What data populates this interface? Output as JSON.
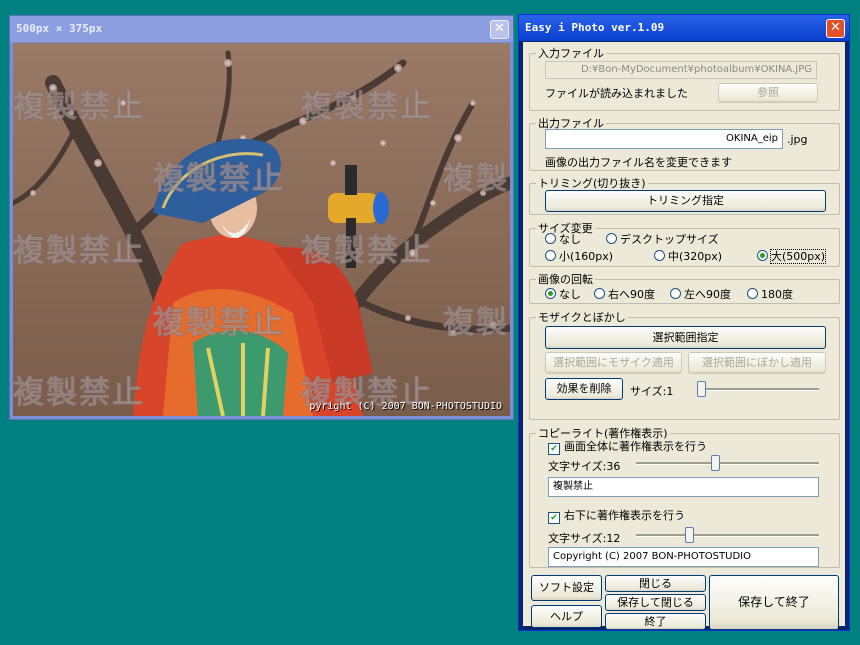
{
  "preview": {
    "title": "500px × 375px",
    "watermark": "複製禁止",
    "copyright_overlay": "pyright (C) 2007 BON-PHOTOSTUDIO"
  },
  "main": {
    "title": "Easy i Photo ver.1.09",
    "input": {
      "legend": "入力ファイル",
      "path": "D:¥Bon-MyDocument¥photoalbum¥OKINA.JPG",
      "status": "ファイルが読み込まれました",
      "browse_label": "参照"
    },
    "output": {
      "legend": "出力ファイル",
      "filename": "OKINA_eip",
      "ext": ".jpg",
      "hint": "画像の出力ファイル名を変更できます"
    },
    "trim": {
      "legend": "トリミング(切り抜き)",
      "button": "トリミング指定"
    },
    "size": {
      "legend": "サイズ変更",
      "options": [
        "なし",
        "デスクトップサイズ",
        "小(160px)",
        "中(320px)",
        "大(500px)"
      ],
      "selected": "大(500px)"
    },
    "rotate": {
      "legend": "画像の回転",
      "options": [
        "なし",
        "右へ90度",
        "左へ90度",
        "180度"
      ],
      "selected": "なし"
    },
    "mosaic": {
      "legend": "モザイクとぼかし",
      "select_area": "選択範囲指定",
      "apply_mosaic": "選択範囲にモザイク適用",
      "apply_blur": "選択範囲にぼかし適用",
      "remove_effect": "効果を削除",
      "size_label": "サイズ:1",
      "size_value": 1,
      "size_fraction": 0.0
    },
    "copyright": {
      "legend": "コピーライト(著作権表示)",
      "full_check": "画面全体に著作権表示を行う",
      "full_checked": true,
      "full_size_label": "文字サイズ:36",
      "full_size_fraction": 0.43,
      "full_text": "複製禁止",
      "corner_check": "右下に著作権表示を行う",
      "corner_checked": true,
      "corner_size_label": "文字サイズ:12",
      "corner_size_fraction": 0.28,
      "corner_text": "Copyright (C) 2007 BON-PHOTOSTUDIO"
    },
    "buttons": {
      "soft_settings": "ソフト設定",
      "help": "ヘルプ",
      "close": "閉じる",
      "save_close": "保存して閉じる",
      "exit": "終了",
      "save_exit": "保存して終了"
    }
  },
  "colors": {
    "desktop": "#008080",
    "title_active": "#0a3fd0",
    "title_preview": "#8c9ee0",
    "window_face": "#ece9d8"
  }
}
